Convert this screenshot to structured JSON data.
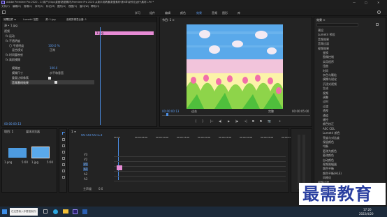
{
  "window": {
    "title": "Adobe Premiere Pro 2020 - C:\\用户\\Oiqu\\桌面\\数据素材\\Premiere Pro 2020 从新手到精通\\数据素材\\第3章\\制作应运行\\素材1.Prl *",
    "controls": [
      "—",
      "□",
      "✕"
    ]
  },
  "menu": [
    "文件(F)",
    "编辑(E)",
    "剪辑(C)",
    "序列(S)",
    "标记(M)",
    "图形(G)",
    "视图(V)",
    "窗口(W)",
    "帮助(H)"
  ],
  "workspaces": [
    "学习",
    "组件",
    "编辑",
    "颜色",
    "效果",
    "音频",
    "图形",
    "库"
  ],
  "active_workspace": "效果",
  "effect_controls": {
    "tabs": [
      "效果控件 ≡",
      "Lumetri 范围",
      "源: 1.jpg",
      "音频剪辑混合器: 1"
    ],
    "source": "源 • 1.jpg",
    "clip": "1.jpg",
    "sections": [
      "视频",
      "fx 运动",
      "fx 不透明度",
      "fx 时间重映射",
      "fx 高斯模糊"
    ],
    "rows": [
      {
        "label": "〇 不透明度",
        "value": "100.0 %"
      },
      {
        "label": "混合模式",
        "value": "正常"
      },
      {
        "label": "模糊度",
        "value": "100.0"
      },
      {
        "label": "模糊尺寸",
        "value": "水平和垂直"
      },
      {
        "label": "重复边缘像素",
        "value": ""
      },
      {
        "label": "音频基线效果",
        "value": ""
      }
    ],
    "clip_bar_label": "1.jpg",
    "timecode": "00:00:00:13"
  },
  "program_monitor": {
    "tab": "节目: 1 ≡",
    "timecode_left": "00:00:00:13",
    "fit": "适合",
    "quality": "完整",
    "timecode_right": "00:00:05:00",
    "transport": [
      "{",
      "}",
      "|←",
      "◀|",
      "▶",
      "|▶",
      "→|",
      "⧉",
      "⧉",
      "📷",
      "+"
    ]
  },
  "project": {
    "tabs": [
      "项目: 1",
      "媒体浏览器"
    ],
    "items": [
      {
        "name": "1.png",
        "meta": "5:00"
      },
      {
        "name": "1.jpg",
        "meta": "5:00"
      }
    ]
  },
  "timeline": {
    "tab": "1 ≡",
    "timecode": "00:00:00:13",
    "ruler": [
      "00:00",
      "00:00:05:00",
      "00:00:10:00",
      "00:00:15:00",
      "00:00:20:00",
      "00:00:25:00",
      "00:00:30:00",
      "00:00:35:00",
      "00:00:40:00"
    ],
    "tracks": [
      "V3",
      "V2",
      "V1",
      "A1",
      "A2",
      "A3"
    ],
    "master": "主声道",
    "master_value": "0.0"
  },
  "effects_panel": {
    "tab": "效果 ≡",
    "items": [
      "预设",
      "Lumetri 预设",
      "音频效果",
      "音频过渡",
      "视频效果",
      "变换",
      "图像控制",
      "实用程序",
      "扭曲",
      "时间",
      "杂色与颗粒",
      "模糊与锐化",
      "沉浸式视频",
      "生成",
      "视频",
      "调整",
      "过时",
      "过渡",
      "透视",
      "通道",
      "键控",
      "颜色校正",
      "ASC CDL",
      "Lumetri 颜色",
      "亮度与对比度",
      "保留颜色",
      "均衡",
      "更改为颜色",
      "更改颜色",
      "自动颜色",
      "视频限幅器",
      "颜色平衡",
      "颜色平衡(HLS)",
      "风格化",
      "视频过渡"
    ]
  },
  "watermark": "最需教育",
  "taskbar": {
    "search": "在这里输入你要搜索的内容",
    "time": "17:20",
    "date": "2022/4/20"
  }
}
